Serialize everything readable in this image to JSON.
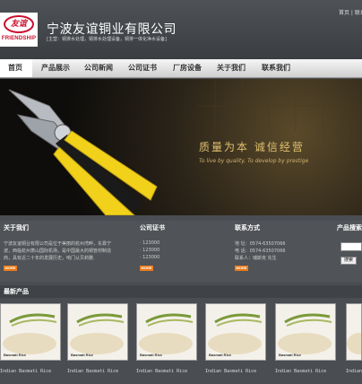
{
  "header": {
    "logo_cn": "友谊",
    "logo_en": "FRIENDSHIP",
    "company_name": "宁波友谊铜业有限公司",
    "slogan": "[主营：铜排水处理，铜排水处理设备，铜排一体化净水设备]",
    "top_links": "首页 | 联系"
  },
  "nav": {
    "items": [
      "首页",
      "产品展示",
      "公司新闻",
      "公司证书",
      "厂房设备",
      "关于我们",
      "联系我们"
    ]
  },
  "banner": {
    "slogan_cn": "质量为本 诚信经营",
    "slogan_en": "To live by quality, To develop by prestige"
  },
  "about": {
    "title": "关于我们",
    "lines": [
      "宁波友谊铜业有限公司是位于美丽的杭州湾畔，东靠宁",
      "波，西临杭州萧山国际机场，是中国最大的铜管材制造",
      "商，具有近二十年的发展历史，响门认贝莉雅."
    ],
    "more": "MORE"
  },
  "cert": {
    "title": "公司证书",
    "items": [
      "· 123000",
      "· 123000",
      "· 123000"
    ],
    "more": "MORE"
  },
  "contact": {
    "title": "联系方式",
    "items": [
      "地  址：0574-63507066",
      "电  话：0574-63507066",
      "联系人：瑞斯克 先生"
    ],
    "more": "MORE"
  },
  "search": {
    "title": "产品搜索",
    "button": "搜索"
  },
  "products": {
    "title": "最新产品",
    "card_label": "Basmati Rice",
    "captions": [
      "Indian Basmati Rice",
      "Indian Basmati Rice",
      "Indian Basmati Rice",
      "Indian Basmati Rice",
      "Indian Basmati Rice",
      "Indian Basmati Rice"
    ]
  },
  "colors": {
    "accent_orange": "#e87a1a",
    "logo_red": "#c8102e",
    "slogan_gold": "#e0c070"
  }
}
